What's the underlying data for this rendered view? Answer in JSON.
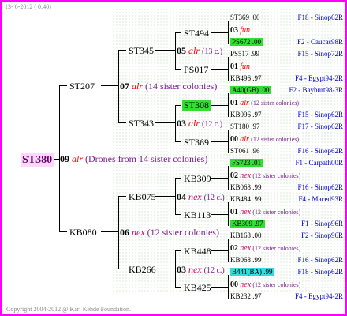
{
  "header_date": "13- 6-2012 ( 0:40)",
  "footer": "Copyright 2004-2012 @ Karl Kehde Foundation.",
  "root": {
    "id": "ST380",
    "gen": "09",
    "breed": "alr",
    "note": "(Drones from 14 sister colonies)"
  },
  "l1": [
    {
      "id": "ST207"
    },
    {
      "id": "KB080",
      "gen": "06",
      "breed": "nex",
      "note": "(12 sister colonies)"
    }
  ],
  "l1_0": {
    "gen": "07",
    "breed": "alr",
    "note": "(14 sister colonies)"
  },
  "l2": [
    {
      "id": "ST345",
      "gen": "05",
      "breed": "alr",
      "note": "(13 c.)"
    },
    {
      "id": "ST343",
      "gen": "03",
      "breed": "alr",
      "note": "(12 c.)"
    },
    {
      "id": "KB075",
      "gen": "04",
      "breed": "nex",
      "note": "(12 c.)"
    },
    {
      "id": "KB266",
      "gen": "03",
      "breed": "nex",
      "note": "(12 c.)"
    }
  ],
  "l3": [
    "ST494",
    "PS017",
    "ST308",
    "ST369",
    "KB309",
    "KB113",
    "KB448",
    "KB425"
  ],
  "l4": [
    {
      "id": "ST369 .00",
      "pos": "F18 - Sinop62R"
    },
    {
      "gen": "03",
      "breed": "fun"
    },
    {
      "id": "PS672 .00",
      "pos": "F2 - Caucas98R"
    },
    {
      "id": "PS517 .99",
      "pos": "F15 - Sinop72R"
    },
    {
      "gen": "01",
      "breed": "fun"
    },
    {
      "id": "KB496 .97",
      "pos": "F4 - Egypt94-2R"
    },
    {
      "id": "A40(GB) .00",
      "pos": "F2 - Bayburt98-3R"
    },
    {
      "gen": "01",
      "breed": "alr",
      "note": "(12 sister colonies)"
    },
    {
      "id": "KB096 .97",
      "pos": "F15 - Sinop62R"
    },
    {
      "id": "ST180 .97",
      "pos": "F17 - Sinop62R"
    },
    {
      "gen": "00",
      "breed": "alr",
      "note": "(12 sister colonies)"
    },
    {
      "id": "ST061 .96",
      "pos": "F16 - Sinop62R"
    },
    {
      "id": "FS723 .01",
      "pos": "F1 - Carpath00R"
    },
    {
      "gen": "02",
      "breed": "nex",
      "note": "(12 sister colonies)"
    },
    {
      "id": "KB068 .99",
      "pos": "F16 - Sinop62R"
    },
    {
      "id": "KB484 .99",
      "pos": "F4 - Maced93R"
    },
    {
      "gen": "01",
      "breed": "nex",
      "note": "(12 sister colonies)"
    },
    {
      "id": "KB309 .97",
      "pos": "F1 - Sinop96R"
    },
    {
      "id": "KB163 .00",
      "pos": "F2 - Sinop96R"
    },
    {
      "gen": "02",
      "breed": "nex",
      "note": "(12 sister colonies)"
    },
    {
      "id": "KB068 .99",
      "pos": "F16 - Sinop62R"
    },
    {
      "id": "B441(BA) .99",
      "pos": "F18 - Sinop62R"
    },
    {
      "gen": "00",
      "breed": "nex",
      "note": "(12 sister colonies)"
    },
    {
      "id": "KB232 .97",
      "pos": "F4 - Egypt94-2R"
    }
  ],
  "colors": {
    "frame": "#ff00ff",
    "highlight_green": "#33dd33",
    "highlight_cyan": "#33dddd",
    "alr": "#ff0000",
    "nex": "#cc0066",
    "position": "#0000cc"
  }
}
